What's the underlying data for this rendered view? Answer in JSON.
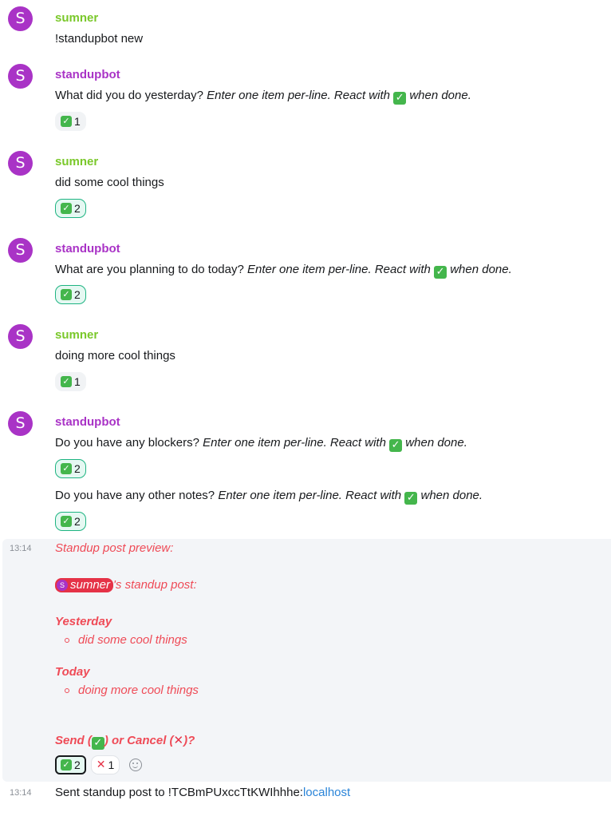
{
  "colors": {
    "user": "#7ac82a",
    "bot": "#a933c6",
    "accent_red": "#ef4b57",
    "link": "#2a84d8"
  },
  "messages": [
    {
      "avatar": "S",
      "sender": "sumner",
      "text": "!standupbot new"
    },
    {
      "avatar": "S",
      "sender": "standupbot",
      "text_plain": "What did you do yesterday?",
      "text_italic_a": "Enter one item per-line. React with",
      "text_italic_b": "when done.",
      "reaction_count": "1"
    },
    {
      "avatar": "S",
      "sender": "sumner",
      "text": "did some cool things",
      "reaction_count": "2"
    },
    {
      "avatar": "S",
      "sender": "standupbot",
      "text_plain": "What are you planning to do today?",
      "text_italic_a": "Enter one item per-line. React with",
      "text_italic_b": "when done.",
      "reaction_count": "2"
    },
    {
      "avatar": "S",
      "sender": "sumner",
      "text": "doing more cool things",
      "reaction_count": "1"
    },
    {
      "avatar": "S",
      "sender": "standupbot",
      "text_plain": "Do you have any blockers?",
      "text_italic_a": "Enter one item per-line. React with",
      "text_italic_b": "when done.",
      "reaction_count": "2",
      "text2_plain": "Do you have any other notes?",
      "text2_italic_a": "Enter one item per-line. React with",
      "text2_italic_b": "when done.",
      "reaction2_count": "2"
    }
  ],
  "preview": {
    "timestamp": "13:14",
    "heading": "Standup post preview:",
    "mention_initial": "S",
    "mention_name": "sumner",
    "mention_suffix": "'s standup post:",
    "yesterday_label": "Yesterday",
    "yesterday_item": "did some cool things",
    "today_label": "Today",
    "today_item": "doing more cool things",
    "prompt_a": "Send (",
    "prompt_b": ") or Cancel (",
    "prompt_c": ")?",
    "check_count": "2",
    "x_count": "1"
  },
  "final": {
    "timestamp": "13:14",
    "text": "Sent standup post to !TCBmPUxccTtKWIhhhe:",
    "link": "localhost"
  }
}
